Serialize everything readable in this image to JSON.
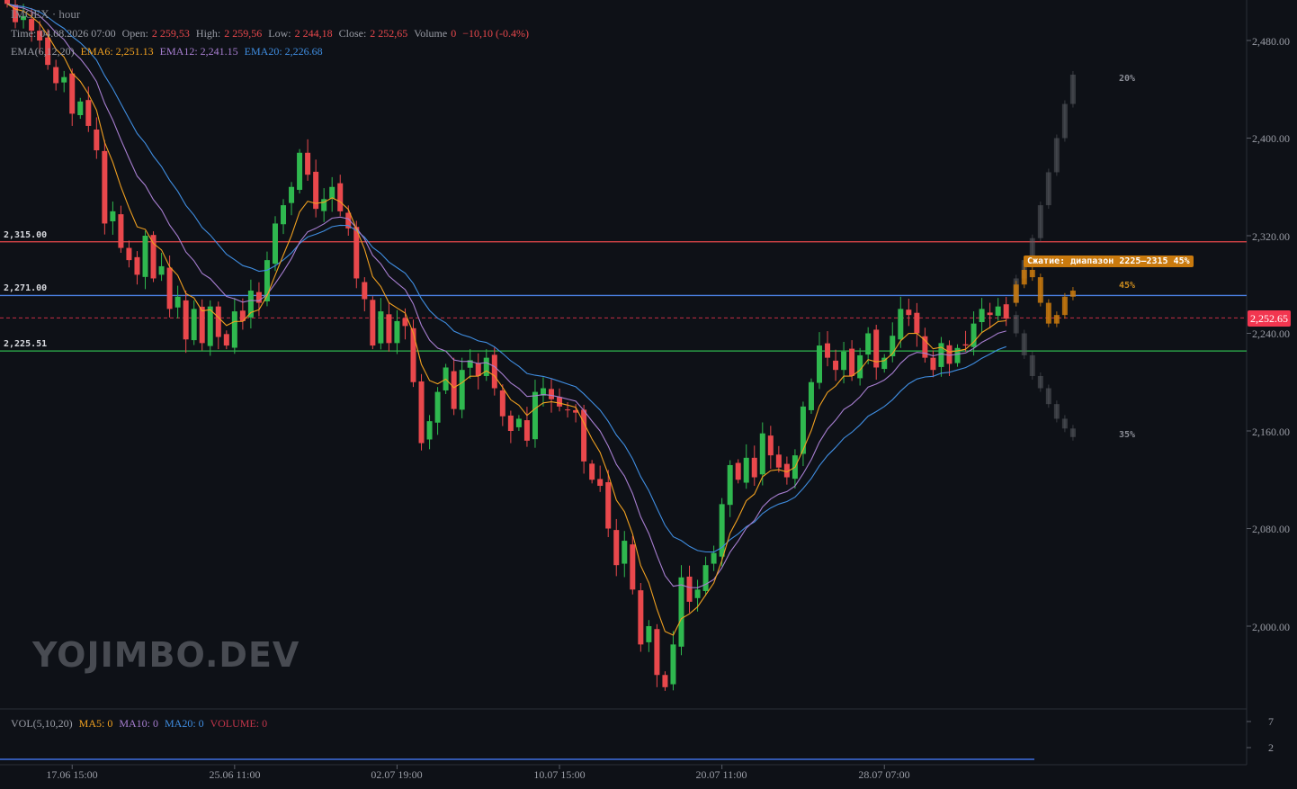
{
  "header": {
    "ticker": "IMOEX · hour",
    "time_label": "Time:",
    "time": "04.08.2026 07:00",
    "open_label": "Open:",
    "open": "2 259,53",
    "high_label": "High:",
    "high": "2 259,56",
    "low_label": "Low:",
    "low": "2 244,18",
    "close_label": "Close:",
    "close": "2 252,65",
    "volume_label": "Volume",
    "volume": "0",
    "change": "−10,10 (-0.4%)"
  },
  "ema_legend": {
    "title": "EMA(6,12,20)",
    "ema6": "EMA6: 2,251.13",
    "ema12": "EMA12: 2,241.15",
    "ema20": "EMA20: 2,226.68"
  },
  "vol_legend": {
    "title": "VOL(5,10,20)",
    "ma5": "MA5: 0",
    "ma10": "MA10: 0",
    "ma20": "MA20: 0",
    "volume": "VOLUME: 0"
  },
  "levels": [
    {
      "value": 2315.0,
      "label": "2,315.00",
      "color": "#e9484c"
    },
    {
      "value": 2271.0,
      "label": "2,271.00",
      "color": "#4a7fe0"
    },
    {
      "value": 2225.51,
      "label": "2,225.51",
      "color": "#2fb84f"
    }
  ],
  "current_price": {
    "value": 2252.65,
    "label": "2,252.65",
    "color": "#f23650"
  },
  "annotations": {
    "badge": "Сжатие: диапазон 2225–2315 45%",
    "pct_up": "20%",
    "pct_mid": "45%",
    "pct_down": "35%"
  },
  "watermark": "YOJIMBO.DEV",
  "colors": {
    "background": "#0e1117",
    "up": "#2fb84f",
    "down": "#e9484c",
    "ema6": "#f0a020",
    "ema12": "#a77ed0",
    "ema20": "#3f8de0",
    "forecast_mid": "#c97a0e"
  },
  "chart_data": {
    "type": "candlestick",
    "y_axis": {
      "min": 1935,
      "max": 2520,
      "ticks": [
        {
          "value": 2480,
          "label": "2,480.00"
        },
        {
          "value": 2400,
          "label": "2,400.00"
        },
        {
          "value": 2320,
          "label": "2,320.00"
        },
        {
          "value": 2240,
          "label": "2,240.00"
        },
        {
          "value": 2160,
          "label": "2,160.00"
        },
        {
          "value": 2080,
          "label": "2,080.00"
        },
        {
          "value": 2000,
          "label": "2,000.00"
        }
      ]
    },
    "volume_axis_ticks": [
      "7",
      "2"
    ],
    "x_axis": {
      "labels": [
        {
          "index": 8,
          "label": "17.06 15:00"
        },
        {
          "index": 28,
          "label": "25.06 11:00"
        },
        {
          "index": 48,
          "label": "02.07 19:00"
        },
        {
          "index": 68,
          "label": "10.07 15:00"
        },
        {
          "index": 88,
          "label": "20.07 11:00"
        },
        {
          "index": 108,
          "label": "28.07 07:00"
        }
      ]
    },
    "closes": [
      2510,
      2495,
      2500,
      2488,
      2480,
      2460,
      2445,
      2450,
      2420,
      2430,
      2410,
      2390,
      2330,
      2340,
      2310,
      2300,
      2288,
      2320,
      2285,
      2295,
      2260,
      2270,
      2235,
      2260,
      2232,
      2262,
      2237,
      2230,
      2258,
      2250,
      2275,
      2265,
      2300,
      2330,
      2345,
      2360,
      2388,
      2370,
      2342,
      2350,
      2360,
      2340,
      2326,
      2285,
      2268,
      2230,
      2258,
      2232,
      2250,
      2246,
      2200,
      2150,
      2168,
      2192,
      2212,
      2178,
      2210,
      2218,
      2205,
      2220,
      2195,
      2172,
      2160,
      2170,
      2152,
      2192,
      2195,
      2186,
      2180,
      2177,
      2175,
      2135,
      2120,
      2115,
      2080,
      2050,
      2070,
      2030,
      1985,
      2000,
      1960,
      1950,
      1985,
      2040,
      2020,
      2030,
      2050,
      2060,
      2100,
      2132,
      2120,
      2138,
      2122,
      2158,
      2140,
      2130,
      2122,
      2140,
      2180,
      2200,
      2230,
      2220,
      2210,
      2225,
      2205,
      2222,
      2240,
      2212,
      2220,
      2238,
      2260,
      2255,
      2240,
      2220,
      2210,
      2232,
      2215,
      2228,
      2230,
      2248,
      2260,
      2255,
      2262,
      2252
    ],
    "forecast": {
      "upper": [
        2265,
        2285,
        2300,
        2318,
        2345,
        2372,
        2400,
        2428,
        2452
      ],
      "middle": [
        2265,
        2280,
        2292,
        2286,
        2265,
        2248,
        2255,
        2270,
        2275
      ],
      "lower": [
        2255,
        2240,
        2222,
        2205,
        2195,
        2182,
        2170,
        2162,
        2155
      ]
    }
  }
}
